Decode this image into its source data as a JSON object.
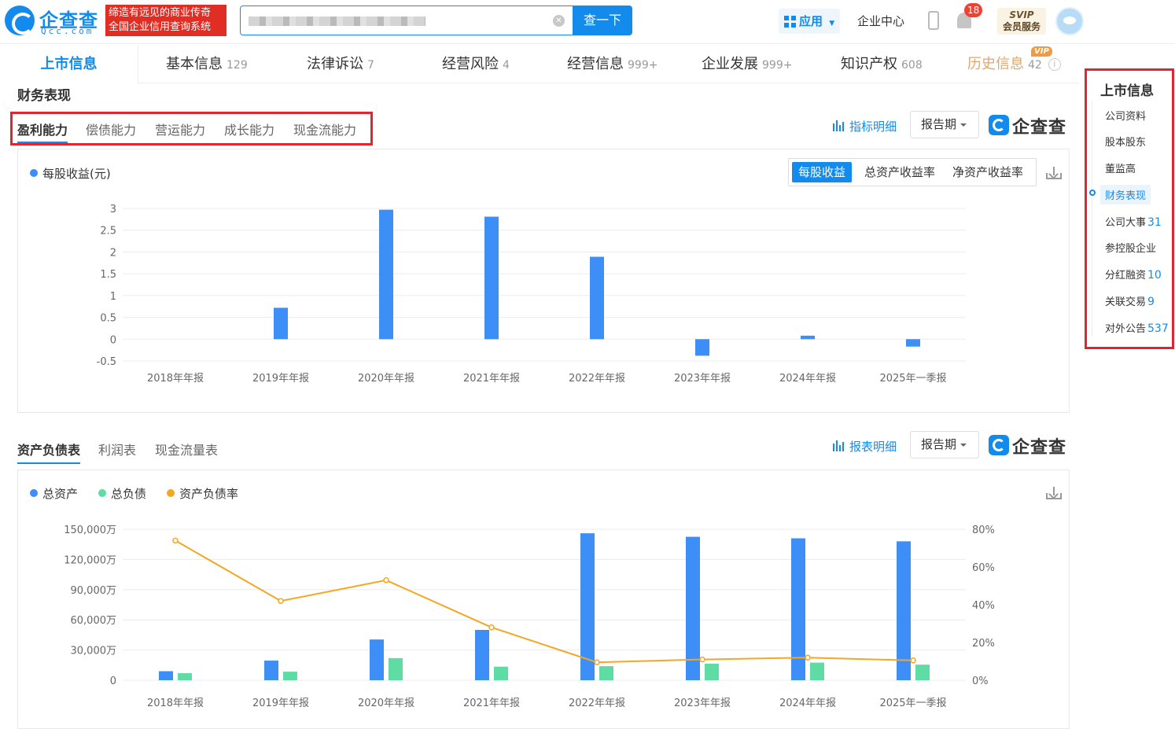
{
  "header": {
    "logo_cn": "企查查",
    "logo_en": "Qcc.com",
    "slogan_line1": "缔造有远见的商业传奇",
    "slogan_line2": "全国企业信用查询系统",
    "search_button": "查一下",
    "app_button": "应用",
    "enterprise_center": "企业中心",
    "notification_count": "18",
    "svip_line1": "SVIP",
    "svip_line2": "会员服务"
  },
  "tabs": [
    {
      "label": "上市信息",
      "count": ""
    },
    {
      "label": "基本信息",
      "count": "129"
    },
    {
      "label": "法律诉讼",
      "count": "7"
    },
    {
      "label": "经营风险",
      "count": "4"
    },
    {
      "label": "经营信息",
      "count": "999+"
    },
    {
      "label": "企业发展",
      "count": "999+"
    },
    {
      "label": "知识产权",
      "count": "608"
    },
    {
      "label": "历史信息",
      "count": "42"
    }
  ],
  "vip_tag": "VIP",
  "section_title": "财务表现",
  "sub_tabs": [
    "盈利能力",
    "偿债能力",
    "营运能力",
    "成长能力",
    "现金流能力"
  ],
  "metric_detail_link": "指标明细",
  "report_detail_link": "报表明细",
  "period_select": "报告期",
  "qcc_mark": "企查查",
  "chart1_toggle": [
    "每股收益",
    "总资产收益率",
    "净资产收益率"
  ],
  "table_tabs": [
    "资产负债表",
    "利润表",
    "现金流量表"
  ],
  "right_nav": {
    "title": "上市信息",
    "items": [
      {
        "label": "公司资料",
        "count": ""
      },
      {
        "label": "股本股东",
        "count": ""
      },
      {
        "label": "董监高",
        "count": ""
      },
      {
        "label": "财务表现",
        "count": ""
      },
      {
        "label": "公司大事",
        "count": "31"
      },
      {
        "label": "参控股企业",
        "count": ""
      },
      {
        "label": "分红融资",
        "count": "10"
      },
      {
        "label": "关联交易",
        "count": "9"
      },
      {
        "label": "对外公告",
        "count": "537"
      }
    ]
  },
  "colors": {
    "accent": "#128bed",
    "bar_blue": "#3d8ef7",
    "bar_green": "#5fdca3",
    "line_orange": "#f5a623",
    "highlight_red": "#e0252e"
  },
  "chart_data": [
    {
      "type": "bar",
      "series": [
        {
          "name": "每股收益(元)",
          "values": [
            0,
            0.72,
            2.97,
            2.81,
            1.89,
            -0.38,
            0.08,
            -0.17
          ]
        }
      ],
      "categories": [
        "2018年年报",
        "2019年年报",
        "2020年年报",
        "2021年年报",
        "2022年年报",
        "2023年年报",
        "2024年年报",
        "2025年一季报"
      ],
      "y_ticks": [
        "3",
        "2.5",
        "2",
        "1.5",
        "1",
        "0.5",
        "0",
        "-0.5"
      ],
      "ylim": [
        -0.5,
        3
      ],
      "grid": true,
      "legend": "top-left"
    },
    {
      "type": "bar",
      "categories": [
        "2018年年报",
        "2019年年报",
        "2020年年报",
        "2021年年报",
        "2022年年报",
        "2023年年报",
        "2024年年报",
        "2025年一季报"
      ],
      "series": [
        {
          "name": "总资产",
          "kind": "bar",
          "axis": "left",
          "values": [
            9000,
            19500,
            40500,
            50000,
            146000,
            142500,
            141000,
            138000
          ]
        },
        {
          "name": "总负债",
          "kind": "bar",
          "axis": "left",
          "values": [
            7000,
            8500,
            22000,
            13500,
            14000,
            16500,
            17500,
            15500
          ]
        },
        {
          "name": "资产负债率",
          "kind": "line",
          "axis": "right",
          "values": [
            74,
            42,
            53,
            28,
            9.5,
            11,
            12,
            10.5
          ]
        }
      ],
      "y_left_ticks": [
        "150,000万",
        "120,000万",
        "90,000万",
        "60,000万",
        "30,000万",
        "0"
      ],
      "y_right_ticks": [
        "80%",
        "60%",
        "40%",
        "20%",
        "0%"
      ],
      "ylim_left": [
        0,
        150000
      ],
      "ylim_right": [
        0,
        80
      ],
      "grid": true,
      "legend": "top-left"
    }
  ]
}
